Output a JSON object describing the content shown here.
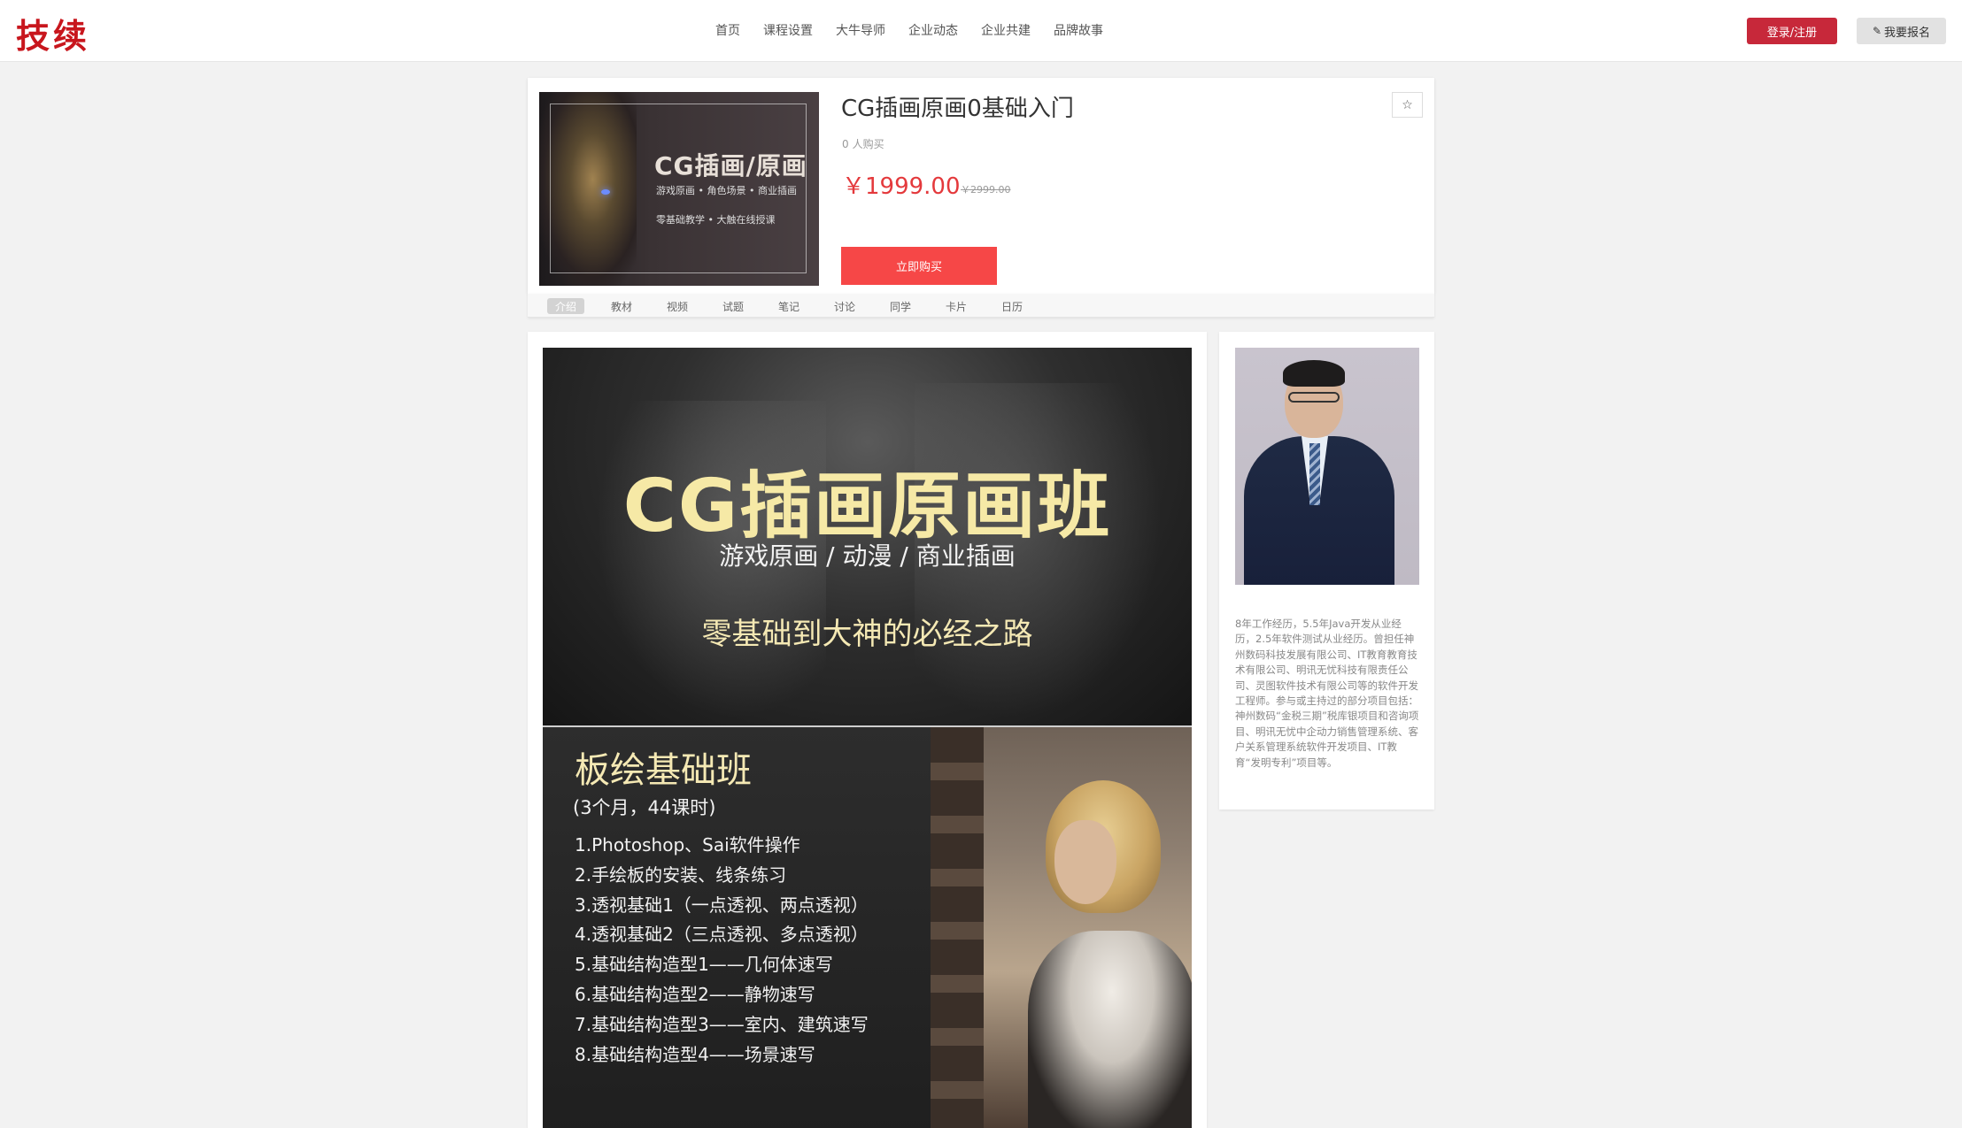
{
  "header": {
    "logo": "技续",
    "nav": [
      "首页",
      "课程设置",
      "大牛导师",
      "企业动态",
      "企业共建",
      "品牌故事"
    ],
    "login_label": "登录/注册",
    "signup_label": "我要报名"
  },
  "course": {
    "cover": {
      "title": "CG插画/原画",
      "subtitle1": "游戏原画 • 角色场景 • 商业插画",
      "subtitle2": "零基础教学 • 大触在线授课"
    },
    "title": "CG插画原画0基础入门",
    "buyers_count": "0",
    "buyers_label": "人购买",
    "price": "￥1999.00",
    "original_price": "￥2999.00",
    "buy_label": "立即购买",
    "favorite_icon": "star-icon"
  },
  "tabs": [
    "介绍",
    "教材",
    "视频",
    "试题",
    "笔记",
    "讨论",
    "同学",
    "卡片",
    "日历"
  ],
  "active_tab": "介绍",
  "poster": {
    "title": "CG插画原画班",
    "subtitle": "游戏原画 / 动漫 / 商业插画",
    "slogan": "零基础到大神的必经之路",
    "class_title": "板绘基础班",
    "class_duration": "(3个月，44课时)",
    "syllabus": [
      "1.Photoshop、Sai软件操作",
      "2.手绘板的安装、线条练习",
      "3.透视基础1（一点透视、两点透视）",
      "4.透视基础2（三点透视、多点透视）",
      "5.基础结构造型1——几何体速写",
      "6.基础结构造型2——静物速写",
      "7.基础结构造型3——室内、建筑速写",
      "8.基础结构造型4——场景速写"
    ]
  },
  "teacher": {
    "bio": "8年工作经历，5.5年Java开发从业经历，2.5年软件测试从业经历。曾担任神州数码科技发展有限公司、IT教育教育技术有限公司、明讯无忧科技有限责任公司、灵图软件技术有限公司等的软件开发工程师。参与或主持过的部分项目包括：神州数码“金税三期”税库银项目和咨询项目、明讯无忧中企动力销售管理系统、客户关系管理系统软件开发项目、IT教育“发明专利”项目等。"
  },
  "colors": {
    "brand_red": "#c8161d",
    "login_button": "#c7283a",
    "buy_button": "#f64747",
    "price": "#e4393c",
    "poster_gold": "#f6e9a6"
  }
}
